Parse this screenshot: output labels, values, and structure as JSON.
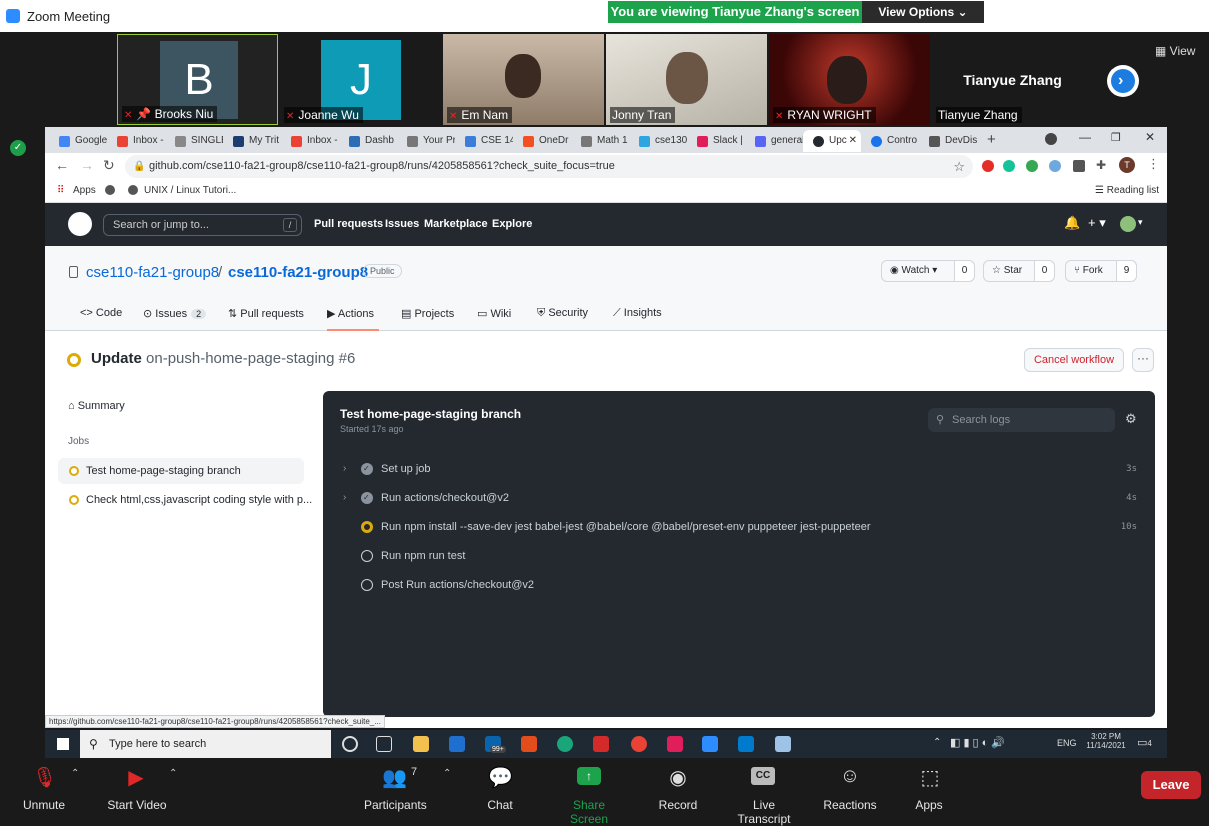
{
  "zoom": {
    "window_title": "Zoom Meeting",
    "share_banner": "You are viewing Tianyue Zhang's screen",
    "view_options": "View Options",
    "gallery_view_label": "View",
    "participants": [
      {
        "name": "Brooks Niu",
        "initial": "B"
      },
      {
        "name": "Joanne Wu",
        "initial": "J"
      },
      {
        "name": "Em Nam"
      },
      {
        "name": "Jonny Tran"
      },
      {
        "name": "RYAN WRIGHT"
      },
      {
        "name": "Tianyue Zhang",
        "big_name": "Tianyue Zhang"
      }
    ],
    "controls": {
      "unmute": "Unmute",
      "start_video": "Start Video",
      "participants": "Participants",
      "participant_count": "7",
      "chat": "Chat",
      "share_screen": "Share Screen",
      "record": "Record",
      "live_transcript": "Live Transcript",
      "reactions": "Reactions",
      "apps": "Apps",
      "leave": "Leave"
    },
    "colors": {
      "share_green": "#1da34c",
      "leave_red": "#c4252b",
      "zoom_blue": "#2d8cff"
    }
  },
  "browser": {
    "tabs": [
      "Google",
      "Inbox -",
      "SINGLE",
      "My Trit",
      "Inbox -",
      "Dashb",
      "Your Pr",
      "CSE 14",
      "OneDr",
      "Math 1",
      "cse130",
      "Slack |",
      "general",
      "Upc",
      "Contro",
      "DevDis"
    ],
    "url": "github.com/cse110-fa21-group8/cse110-fa21-group8/runs/4205858561?check_suite_focus=true",
    "bookmarks": [
      "Apps",
      "UNIX / Linux Tutori..."
    ],
    "reading_list": "Reading list",
    "status_url": "https://github.com/cse110-fa21-group8/cse110-fa21-group8/runs/4205858561?check_suite_..."
  },
  "github": {
    "search_placeholder": "Search or jump to...",
    "search_key": "/",
    "nav": [
      "Pull requests",
      "Issues",
      "Marketplace",
      "Explore"
    ],
    "owner": "cse110-fa21-group8",
    "separator": "/",
    "repo": "cse110-fa21-group8",
    "visibility": "Public",
    "watch": {
      "label": "Watch",
      "count": "0"
    },
    "star": {
      "label": "Star",
      "count": "0"
    },
    "fork": {
      "label": "Fork",
      "count": "9"
    },
    "repo_tabs": [
      {
        "label": "Code"
      },
      {
        "label": "Issues",
        "badge": "2"
      },
      {
        "label": "Pull requests"
      },
      {
        "label": "Actions"
      },
      {
        "label": "Projects"
      },
      {
        "label": "Wiki"
      },
      {
        "label": "Security"
      },
      {
        "label": "Insights"
      }
    ],
    "workflow": {
      "title_bold": "Update",
      "title_rest": "on-push-home-page-staging #6",
      "cancel": "Cancel workflow",
      "more": "···"
    },
    "sidebar": {
      "summary": "Summary",
      "jobs_heading": "Jobs",
      "jobs": [
        "Test home-page-staging branch",
        "Check html,css,javascript coding style with p..."
      ]
    },
    "log": {
      "job_title": "Test home-page-staging branch",
      "started": "Started 17s ago",
      "search_placeholder": "Search logs",
      "steps": [
        {
          "label": "Set up job",
          "time": "3s",
          "status": "done"
        },
        {
          "label": "Run actions/checkout@v2",
          "time": "4s",
          "status": "done"
        },
        {
          "label": "Run npm install --save-dev jest babel-jest @babel/core @babel/preset-env puppeteer jest-puppeteer",
          "time": "10s",
          "status": "running"
        },
        {
          "label": "Run npm run test",
          "time": "",
          "status": "pending"
        },
        {
          "label": "Post Run actions/checkout@v2",
          "time": "",
          "status": "pending"
        }
      ]
    }
  },
  "taskbar": {
    "search_placeholder": "Type here to search",
    "lang": "ENG",
    "time": "3:02 PM",
    "date": "11/14/2021",
    "badge": "99+",
    "notif": "4"
  }
}
